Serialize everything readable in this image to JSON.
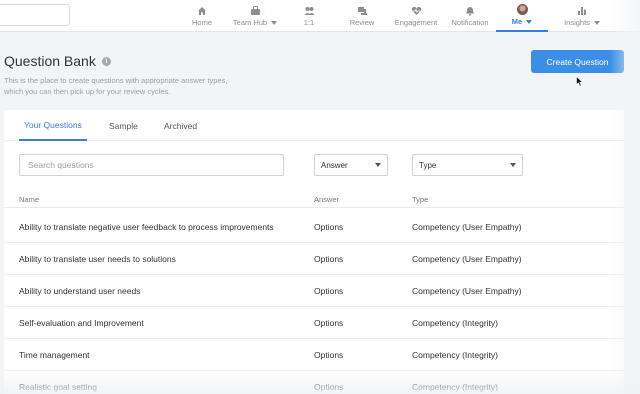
{
  "nav": {
    "items": [
      {
        "label": "Home",
        "icon": "home-icon"
      },
      {
        "label": "Team Hub",
        "icon": "team-hub-icon"
      },
      {
        "label": "1:1",
        "icon": "one-on-one-icon"
      },
      {
        "label": "Review",
        "icon": "review-icon"
      },
      {
        "label": "Engagement",
        "icon": "heart-pulse-icon"
      },
      {
        "label": "Notification",
        "icon": "bell-icon"
      },
      {
        "label": "Me",
        "icon": "avatar"
      },
      {
        "label": "Insights",
        "icon": "bar-chart-icon"
      }
    ],
    "active": "Me",
    "accent": "#3a7de0"
  },
  "header": {
    "title": "Question Bank",
    "description_line1": "This is the place to create questions with appropriate answer types,",
    "description_line2": "which you can then pick up for your review cycles.",
    "create_button": "Create Question",
    "button_color": "#3a8ee6"
  },
  "tabs": [
    "Your Questions",
    "Sample",
    "Archived"
  ],
  "filters": {
    "search_placeholder": "Search questions",
    "answer_select": "Answer",
    "type_select": "Type"
  },
  "table": {
    "columns": [
      "Name",
      "Answer",
      "Type"
    ],
    "rows": [
      {
        "name": "Ability to translate negative user feedback to process improvements",
        "answer": "Options",
        "type": "Competency (User Empathy)"
      },
      {
        "name": "Ability to translate user needs to solutions",
        "answer": "Options",
        "type": "Competency (User Empathy)"
      },
      {
        "name": "Ability to understand user needs",
        "answer": "Options",
        "type": "Competency (User Empathy)"
      },
      {
        "name": "Self-evaluation and Improvement",
        "answer": "Options",
        "type": "Competency (Integrity)"
      },
      {
        "name": "Time management",
        "answer": "Options",
        "type": "Competency (Integrity)"
      },
      {
        "name": "Realistic goal setting",
        "answer": "Options",
        "type": "Competency (Integrity)"
      }
    ]
  }
}
